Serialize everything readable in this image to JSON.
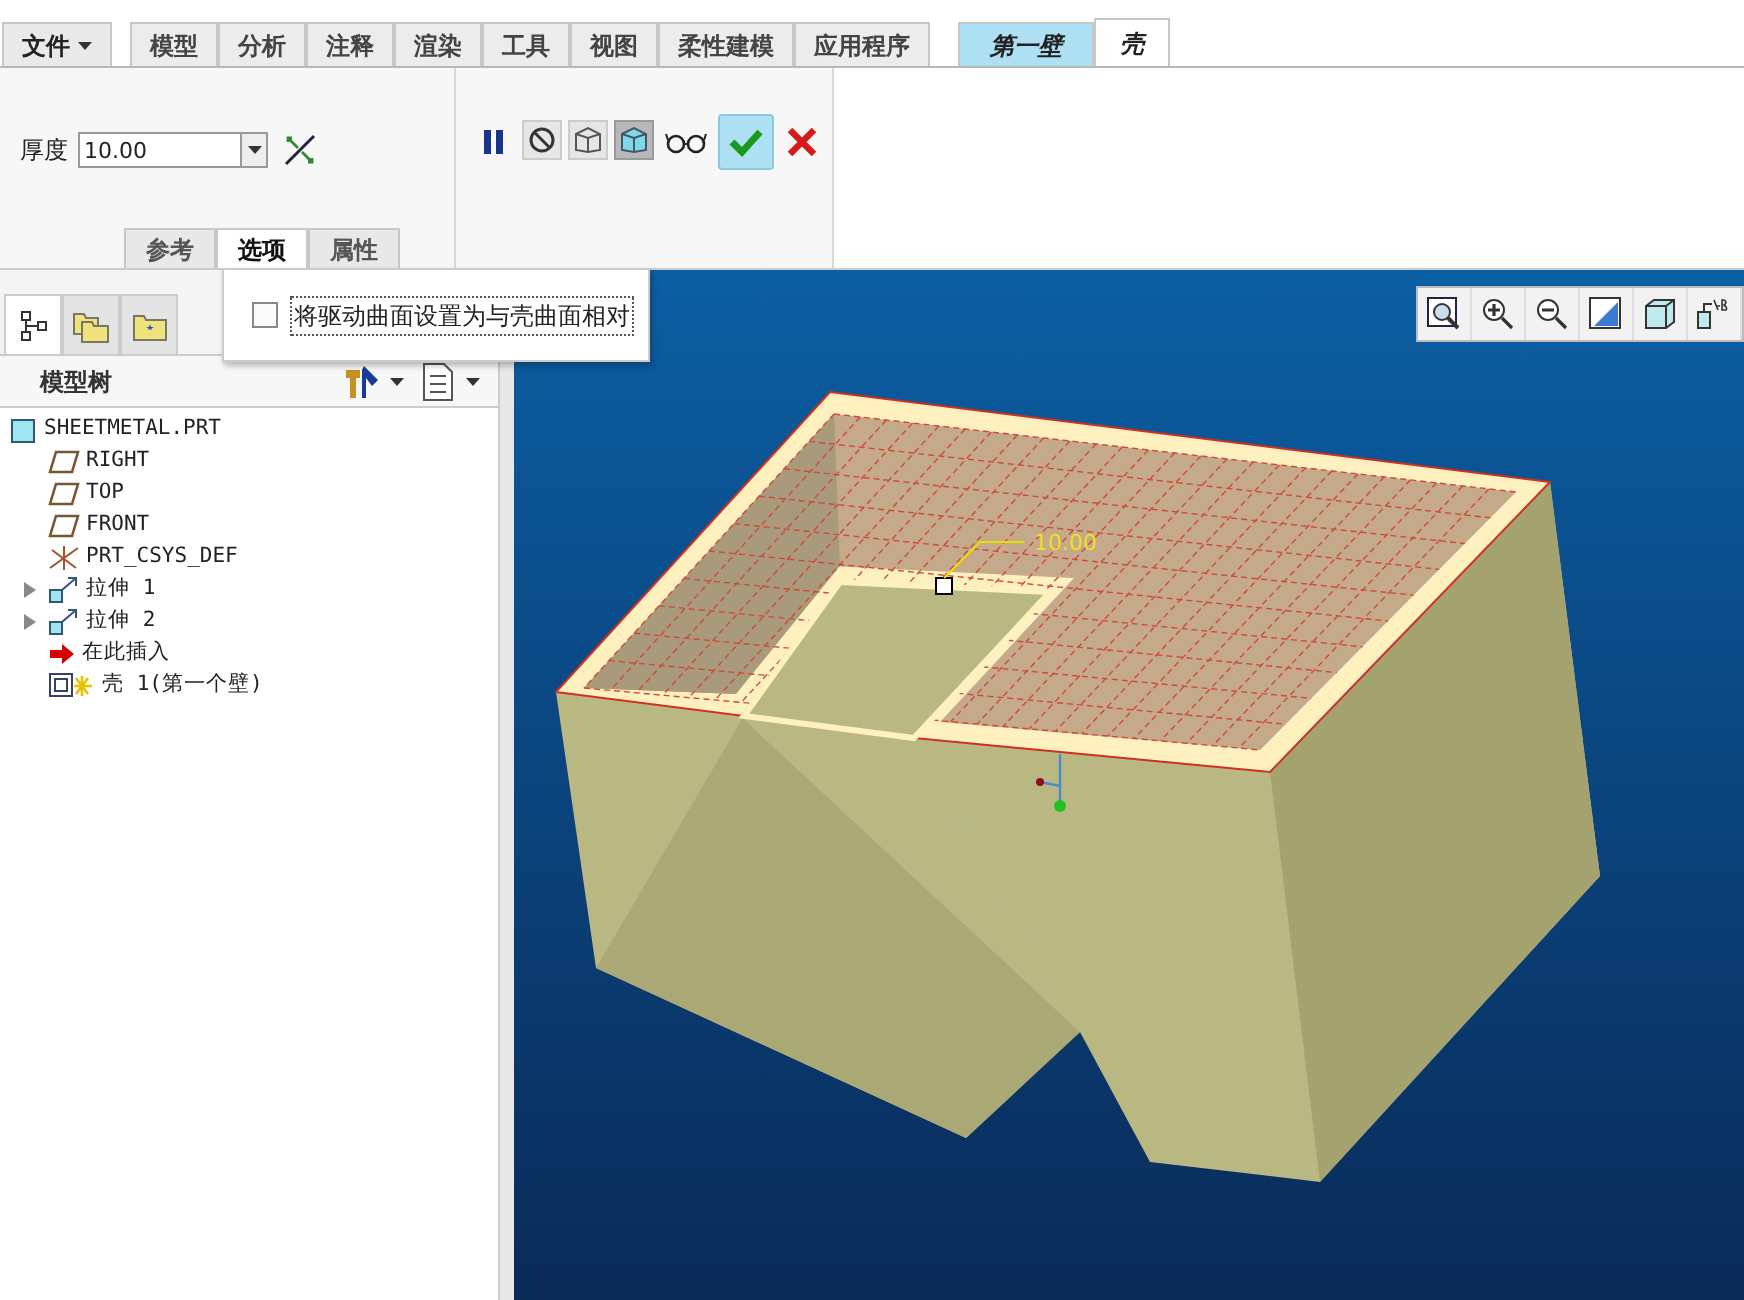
{
  "menu_tabs": [
    {
      "label": "文件",
      "kind": "file",
      "selected": false
    },
    {
      "label": "模型",
      "kind": "main",
      "selected": false
    },
    {
      "label": "分析",
      "kind": "main",
      "selected": false
    },
    {
      "label": "注释",
      "kind": "main",
      "selected": false
    },
    {
      "label": "渲染",
      "kind": "main",
      "selected": false
    },
    {
      "label": "工具",
      "kind": "main",
      "selected": false
    },
    {
      "label": "视图",
      "kind": "main",
      "selected": false
    },
    {
      "label": "柔性建模",
      "kind": "main",
      "selected": false
    },
    {
      "label": "应用程序",
      "kind": "main",
      "selected": false
    },
    {
      "label": "第一壁",
      "kind": "context",
      "selected": false
    },
    {
      "label": "壳",
      "kind": "context",
      "selected": true
    }
  ],
  "thickness": {
    "label": "厚度",
    "value": "10.00"
  },
  "sub_tabs": [
    {
      "label": "参考",
      "selected": false
    },
    {
      "label": "选项",
      "selected": true
    },
    {
      "label": "属性",
      "selected": false
    }
  ],
  "options_popup": {
    "checkbox_label": "将驱动曲面设置为与壳曲面相对",
    "checked": false
  },
  "navigator_tabs": [
    {
      "kind": "tree",
      "selected": true
    },
    {
      "kind": "folders",
      "selected": false
    },
    {
      "kind": "favorites",
      "selected": false
    }
  ],
  "model_tree": {
    "title": "模型树",
    "items": [
      {
        "label": "SHEETMETAL.PRT",
        "kind": "part"
      },
      {
        "label": "RIGHT",
        "kind": "plane"
      },
      {
        "label": "TOP",
        "kind": "plane"
      },
      {
        "label": "FRONT",
        "kind": "plane"
      },
      {
        "label": "PRT_CSYS_DEF",
        "kind": "csys"
      },
      {
        "label": "拉伸 1",
        "kind": "extrude",
        "expanded": false
      },
      {
        "label": "拉伸 2",
        "kind": "extrude",
        "expanded": false
      },
      {
        "label": "在此插入",
        "kind": "insert"
      },
      {
        "label": "壳 1(第一个壁)",
        "kind": "shell"
      }
    ]
  },
  "viewport": {
    "dimension": "10.00"
  }
}
